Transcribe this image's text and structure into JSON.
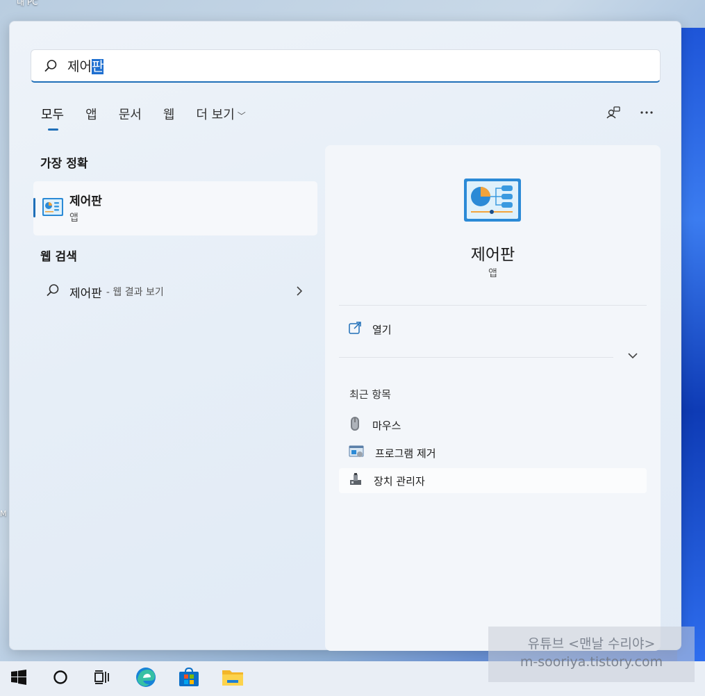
{
  "desktop": {
    "label_top": "내 PC",
    "label_edge": "M"
  },
  "search": {
    "query_prefix": "제어",
    "query_selected": "판"
  },
  "tabs": [
    {
      "label": "모두",
      "active": true
    },
    {
      "label": "앱"
    },
    {
      "label": "문서"
    },
    {
      "label": "웹"
    },
    {
      "label": "더 보기"
    }
  ],
  "best_match": {
    "section_title": "가장 정확",
    "name": "제어판",
    "type": "앱"
  },
  "web_search": {
    "section_title": "웹 검색",
    "query": "제어판",
    "suffix": "- 웹 결과 보기"
  },
  "detail": {
    "name": "제어판",
    "type": "앱",
    "open_label": "열기",
    "recent_title": "최근 항목",
    "recent_items": [
      {
        "label": "마우스",
        "icon": "mouse-icon"
      },
      {
        "label": "프로그램 제거",
        "icon": "programs-icon"
      },
      {
        "label": "장치 관리자",
        "icon": "device-manager-icon"
      }
    ]
  },
  "watermark": {
    "line1": "유튜브 <맨날 수리야>",
    "line2": "m-sooriya.tistory.com"
  },
  "colors": {
    "accent": "#1f6fb8",
    "selection": "#1e6fd0",
    "panel": "#e6eef7"
  }
}
